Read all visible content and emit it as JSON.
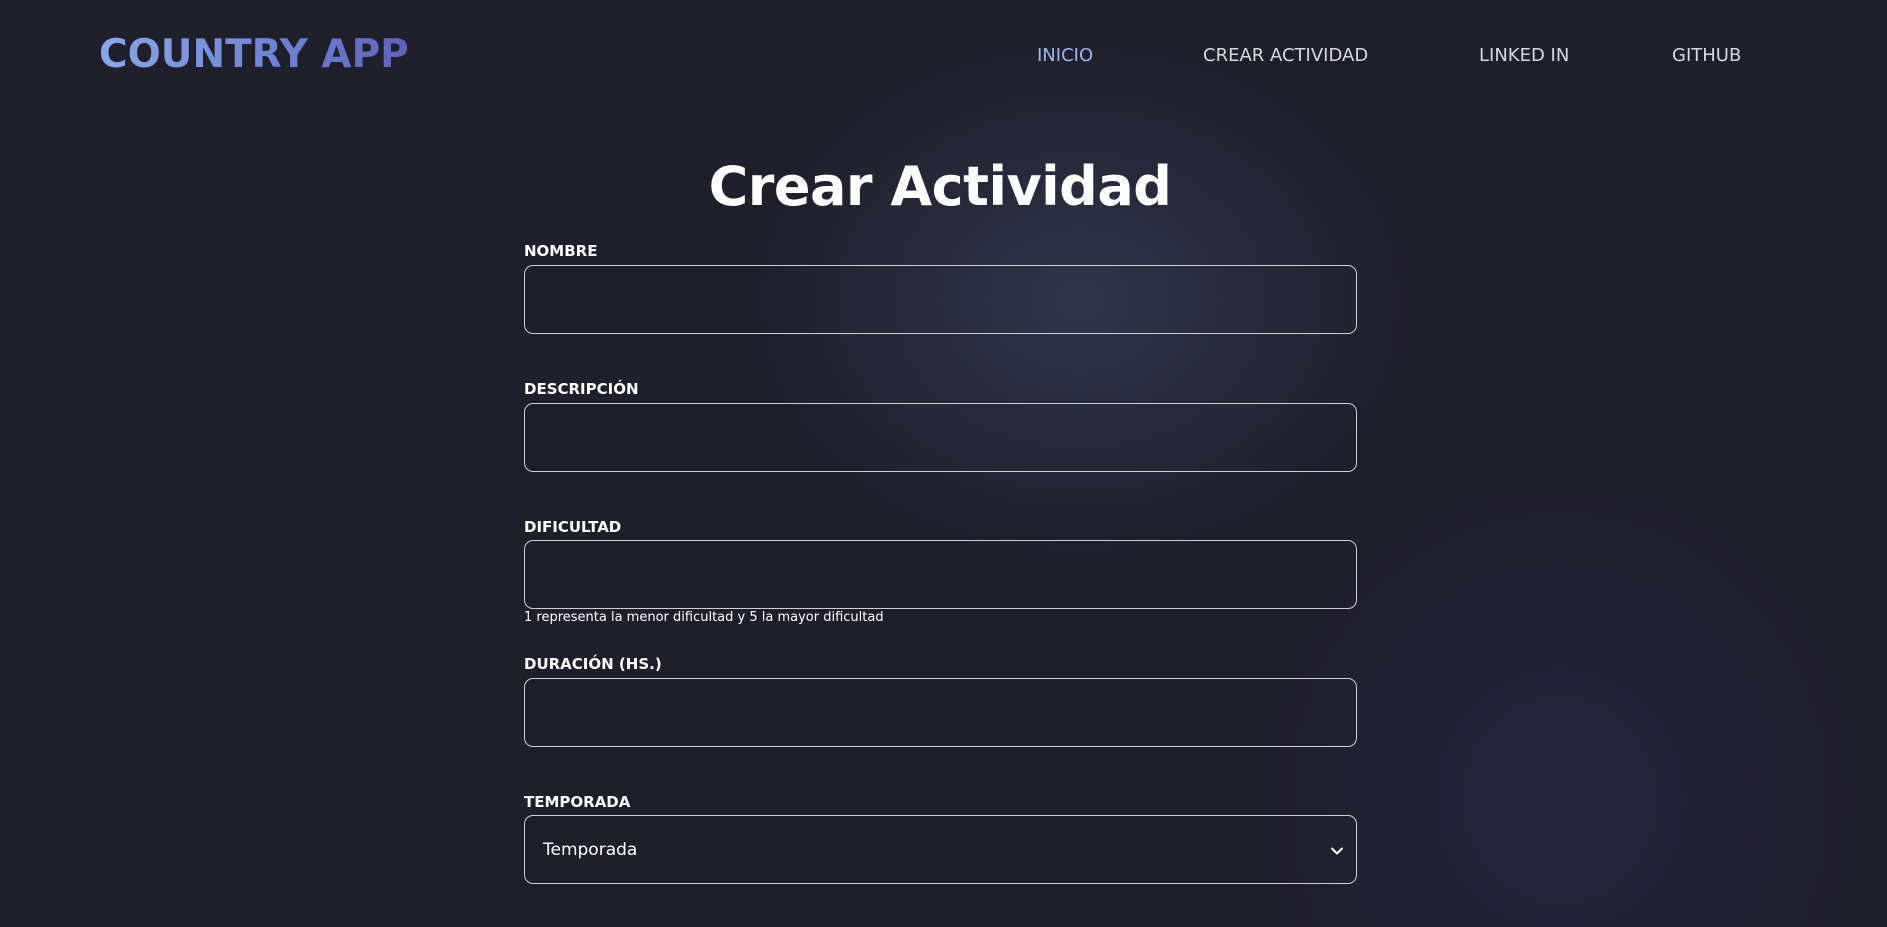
{
  "navbar": {
    "logo": "COUNTRY APP",
    "links": [
      {
        "label": "INICIO",
        "active": true
      },
      {
        "label": "CREAR ACTIVIDAD",
        "active": false
      },
      {
        "label": "LINKED IN",
        "active": false
      },
      {
        "label": "GITHUB",
        "active": false
      }
    ]
  },
  "form": {
    "title": "Crear Actividad",
    "nombre": {
      "label": "NOMBRE",
      "value": ""
    },
    "descripcion": {
      "label": "DESCRIPCIÓN",
      "value": ""
    },
    "dificultad": {
      "label": "DIFICULTAD",
      "value": "",
      "hint": "1 representa la menor dificultad y 5 la mayor dificultad"
    },
    "duracion": {
      "label": "DURACIÓN (HS.)",
      "value": ""
    },
    "temporada": {
      "label": "TEMPORADA",
      "selected": "Temporada",
      "icon": "chevron-down-icon"
    }
  },
  "colors": {
    "background": "#1f1e2b",
    "accent": "#9fb7e8",
    "logo_start": "#8aa8e6",
    "logo_end": "#5e62b8",
    "input_border": "#cfcfd8"
  }
}
